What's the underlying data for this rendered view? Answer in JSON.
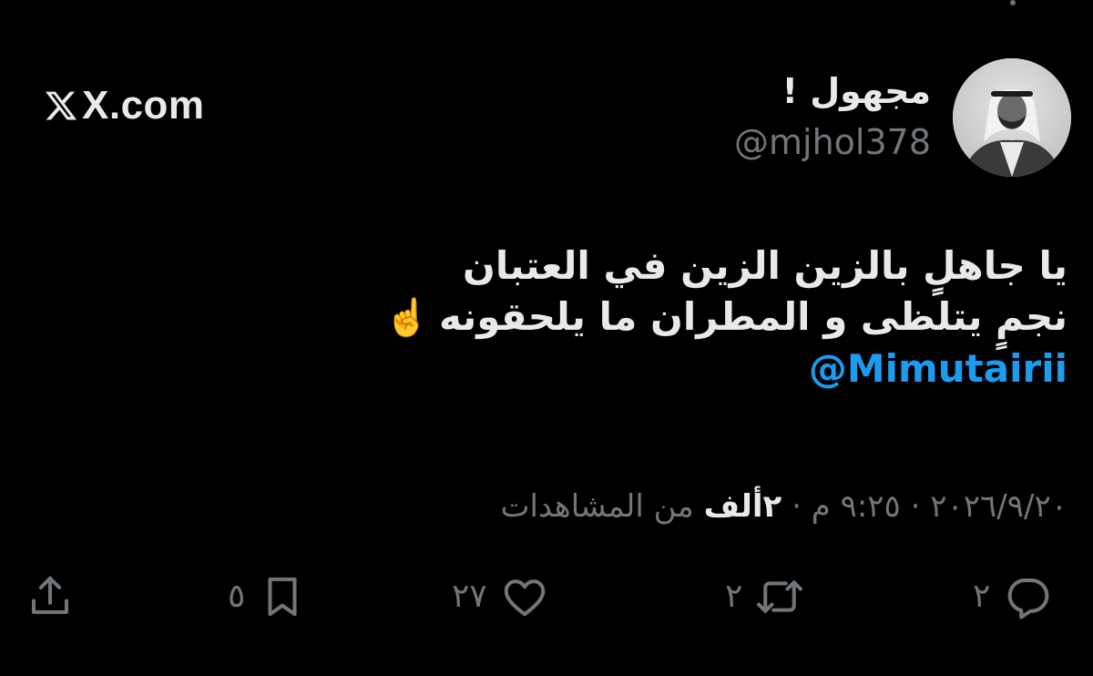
{
  "brand": {
    "text": "X.com",
    "icon": "x-logo-icon"
  },
  "author": {
    "display_name": "مجهول !",
    "handle": "@mjhol378",
    "avatar": "avatar-image"
  },
  "tweet": {
    "line1": "يا جاهلٍ بالزين الزين في العتبان",
    "line2": "نجمٍ يتلظى و المطران ما يلحقونه",
    "emoji": "☝️",
    "mention": "@Mimutairii"
  },
  "meta": {
    "date": "٢٠٢٦/٩/٢٠",
    "time": "٩:٢٥ م",
    "views_count": "٢ألف",
    "views_label": "من المشاهدات",
    "separator": "·"
  },
  "actions": {
    "reply_count": "٢",
    "retweet_count": "٢",
    "like_count": "٢٧",
    "bookmark_count": "٥",
    "icons": [
      "reply-icon",
      "retweet-icon",
      "like-icon",
      "bookmark-icon",
      "share-icon"
    ]
  },
  "colors": {
    "background": "#000000",
    "text": "#e7e9ea",
    "secondary": "#71767b",
    "accent": "#1d9bf0"
  }
}
